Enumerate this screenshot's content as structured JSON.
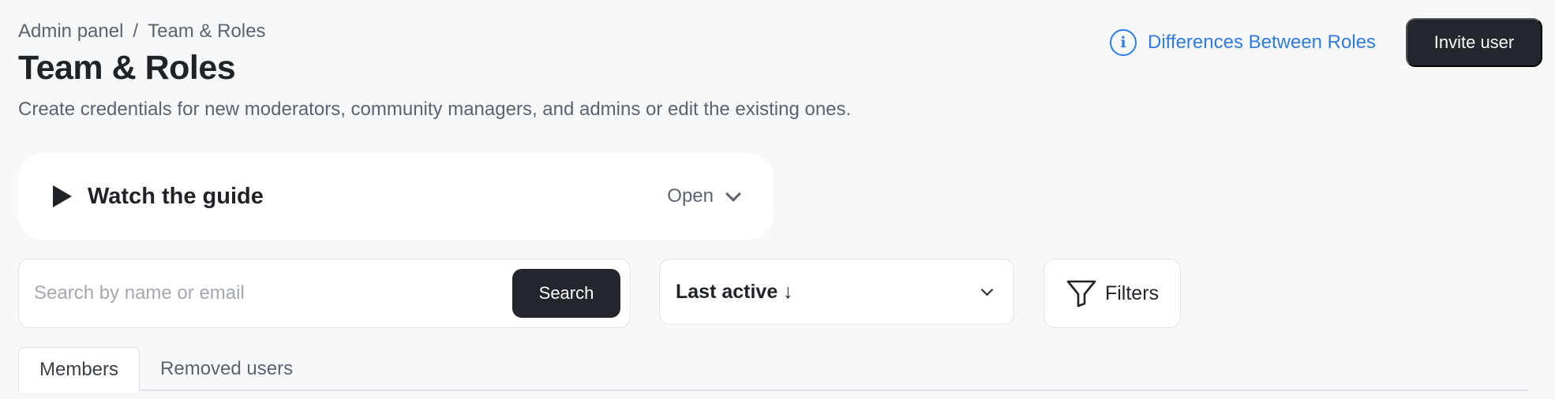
{
  "breadcrumb": {
    "items": [
      "Admin panel",
      "Team & Roles"
    ],
    "separator": "/"
  },
  "header": {
    "title": "Team & Roles",
    "subtitle": "Create credentials for new moderators, community managers, and admins or edit the existing ones.",
    "diff_link_label": "Differences Between Roles",
    "diff_link_icon": "info-icon",
    "invite_button_label": "Invite user"
  },
  "guide": {
    "title": "Watch the guide",
    "toggle_label": "Open",
    "icon": "play-icon"
  },
  "search": {
    "placeholder": "Search by name or email",
    "value": "",
    "button_label": "Search"
  },
  "sort": {
    "selected": "Last active ↓"
  },
  "filters": {
    "label": "Filters",
    "icon": "funnel-icon"
  },
  "tabs": [
    {
      "label": "Members",
      "active": true
    },
    {
      "label": "Removed users",
      "active": false
    }
  ],
  "colors": {
    "accent": "#2f7be5",
    "primary_button": "#23272d",
    "background": "#f7f8fa"
  }
}
